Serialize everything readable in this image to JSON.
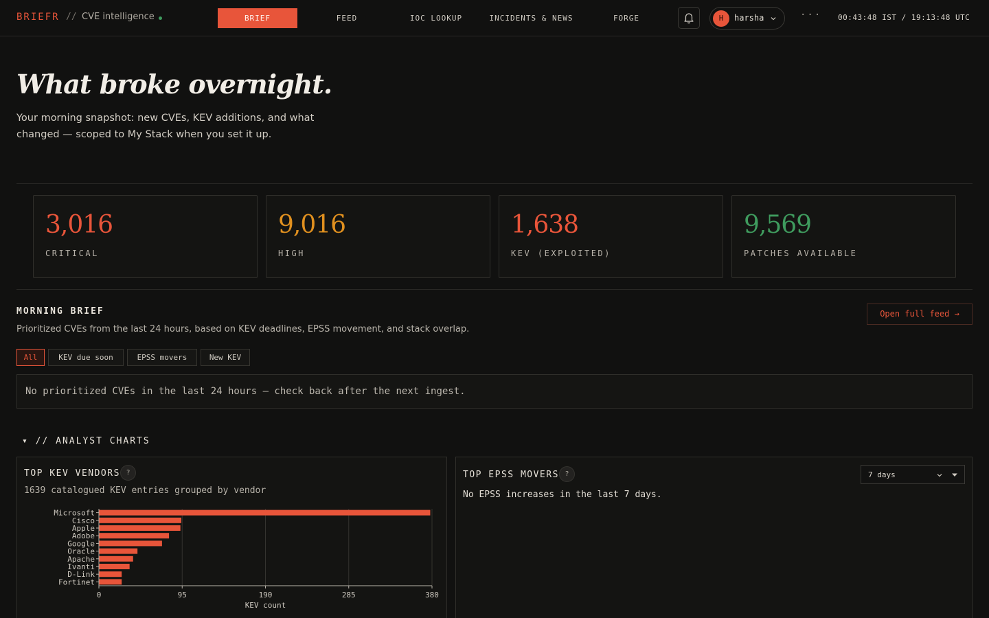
{
  "header": {
    "brand": "BRIEFR",
    "separator": "//",
    "subtitle": "CVE intelligence",
    "nav": [
      "BRIEF",
      "FEED",
      "IOC LOOKUP",
      "INCIDENTS & NEWS",
      "FORGE"
    ],
    "active_nav": "BRIEF",
    "user_initial": "H",
    "user_name": "harsha",
    "more_label": "···",
    "clock": "00:43:48 IST / 19:13:48 UTC"
  },
  "hero": {
    "title": "What broke overnight.",
    "subtitle": "Your morning snapshot: new CVEs, KEV additions, and what changed — scoped to My Stack when you set it up."
  },
  "stats": [
    {
      "value": "3,016",
      "label": "CRITICAL",
      "color": "#e8553a"
    },
    {
      "value": "9,016",
      "label": "HIGH",
      "color": "#e0901f"
    },
    {
      "value": "1,638",
      "label": "KEV (EXPLOITED)",
      "color": "#e8553a"
    },
    {
      "value": "9,569",
      "label": "PATCHES AVAILABLE",
      "color": "#3f9b5e"
    }
  ],
  "brief": {
    "title": "MORNING BRIEF",
    "subtitle": "Prioritized CVEs from the last 24 hours, based on KEV deadlines, EPSS movement, and stack overlap.",
    "open_feed": "Open full feed →",
    "filters": [
      "All",
      "KEV due soon",
      "EPSS movers",
      "New KEV"
    ],
    "active_filter": "All",
    "empty": "No prioritized CVEs in the last 24 hours — check back after the next ingest."
  },
  "charts": {
    "heading": "▾ // ANALYST CHARTS",
    "kev": {
      "title": "TOP KEV VENDORS",
      "help": "?",
      "subtitle": "1639 catalogued KEV entries grouped by vendor"
    },
    "epss": {
      "title": "TOP EPSS MOVERS",
      "help": "?",
      "empty": "No EPSS increases in the last 7 days.",
      "range": "7 days"
    }
  },
  "chart_data": {
    "type": "bar",
    "orientation": "horizontal",
    "categories": [
      "Microsoft",
      "Cisco",
      "Apple",
      "Adobe",
      "Google",
      "Oracle",
      "Apache",
      "Ivanti",
      "D-Link",
      "Fortinet"
    ],
    "values": [
      378,
      94,
      93,
      80,
      72,
      44,
      39,
      35,
      26,
      26
    ],
    "xlabel": "KEV count",
    "ylabel": "",
    "xlim": [
      0,
      380
    ],
    "xticks": [
      0,
      95,
      190,
      285,
      380
    ],
    "grid": true,
    "bar_color": "#e8553a"
  }
}
